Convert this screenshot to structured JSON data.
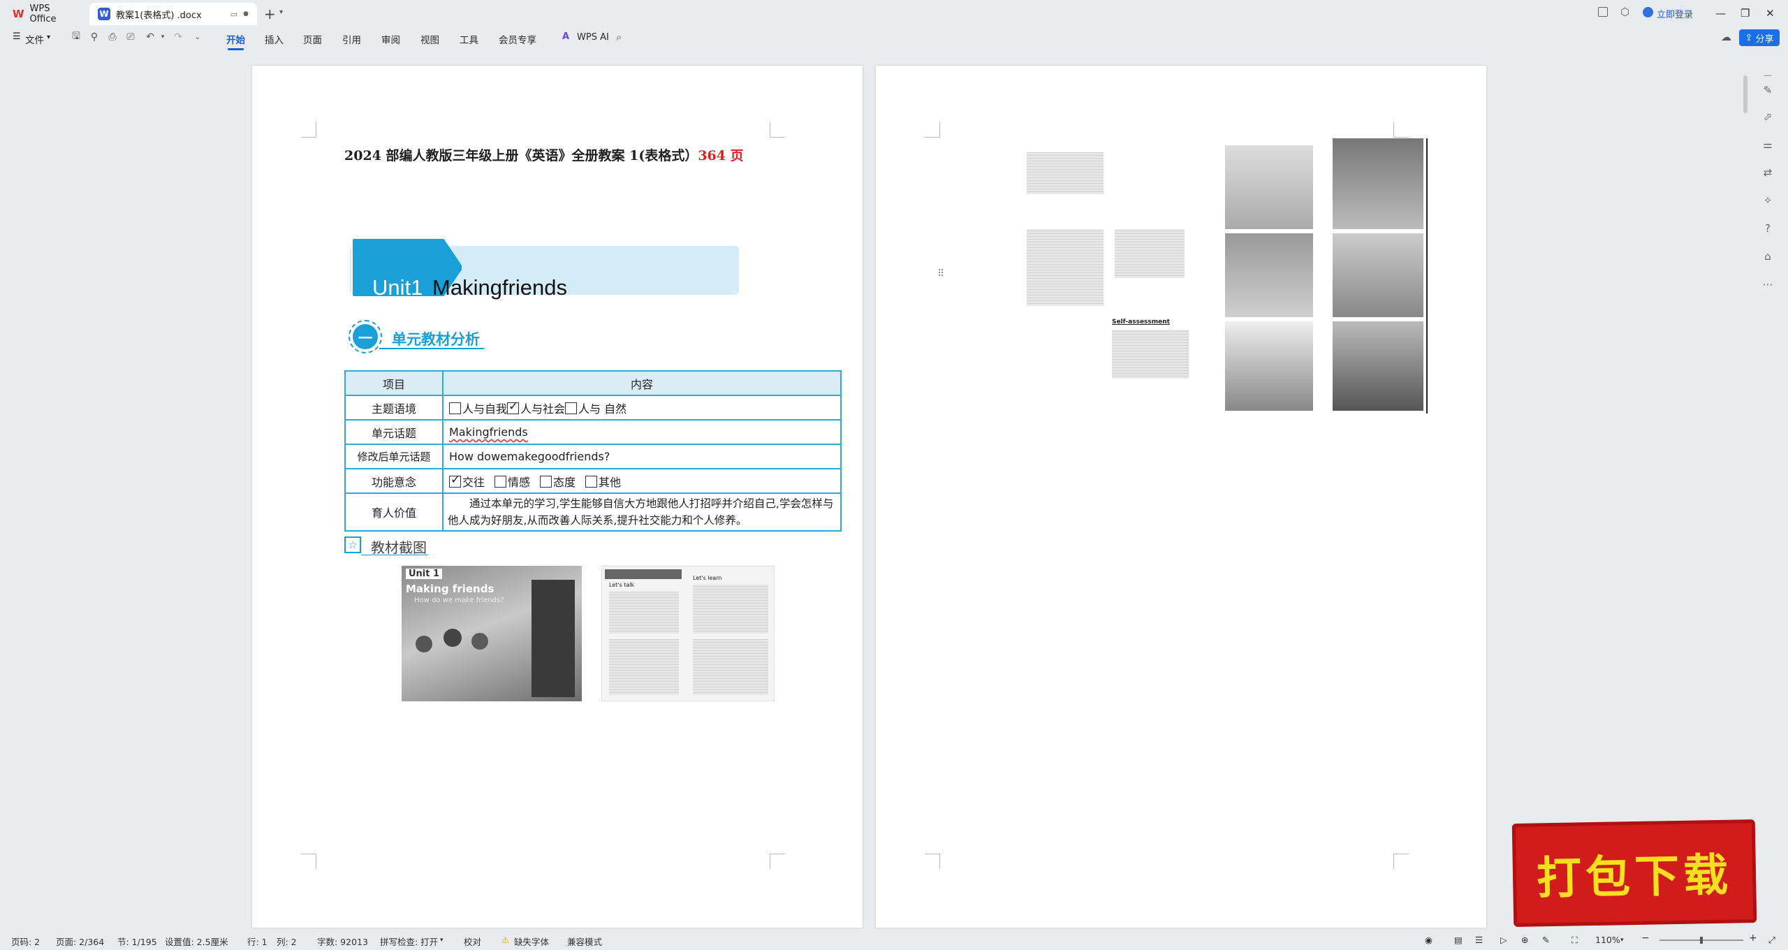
{
  "app": {
    "name": "WPS Office",
    "doc_tab": "教案1(表格式) .docx",
    "login": "立即登录",
    "share": "分享"
  },
  "menu": {
    "file": "文件",
    "tabs": [
      "开始",
      "插入",
      "页面",
      "引用",
      "审阅",
      "视图",
      "工具",
      "会员专享"
    ],
    "wps_ai": "WPS AI"
  },
  "doc": {
    "header_text": "2024 部编人教版三年级上册《英语》全册教案 1(表格式）",
    "header_pages": "364 页",
    "unit_no": "Unit1",
    "unit_title": "Makingfriends",
    "section1_num": "一",
    "section1": "单元教材分析",
    "table": {
      "col1": "项目",
      "col2": "内容",
      "r1_label": "主题语境",
      "r1_opts": [
        "人与自我",
        "人与社会",
        "人与 自然"
      ],
      "r2_label": "单元话题",
      "r2_value": "Makingfriends",
      "r3_label": "修改后单元话题",
      "r3_value": "How dowemakegoodfriends?",
      "r4_label": "功能意念",
      "r4_opts": [
        "交往",
        "情感",
        "态度",
        "其他"
      ],
      "r5_label": "育人价值",
      "r5_value": "通过本单元的学习,学生能够自信大方地跟他人打招呼并介绍自己,学会怎样与他人成为好朋友,从而改善人际关系,提升社交能力和个人修养。"
    },
    "section2": "教材截图",
    "book": {
      "unit": "Unit 1",
      "title": "Making friends",
      "q": "How do we make friends?",
      "l1": "Let's talk",
      "l2": "Let's learn"
    },
    "p2": {
      "self_assessment": "Self-assessment"
    }
  },
  "status": {
    "page": "页码: 2",
    "pages": "页面: 2/364",
    "section": "节: 1/195",
    "setting": "设置值: 2.5厘米",
    "row": "行: 1",
    "col": "列: 2",
    "words": "字数: 92013",
    "spell": "拼写检查: 打开",
    "proof": "校对",
    "font_missing": "缺失字体",
    "compat": "兼容模式",
    "zoom": "110%"
  },
  "watermark": "打包下载"
}
